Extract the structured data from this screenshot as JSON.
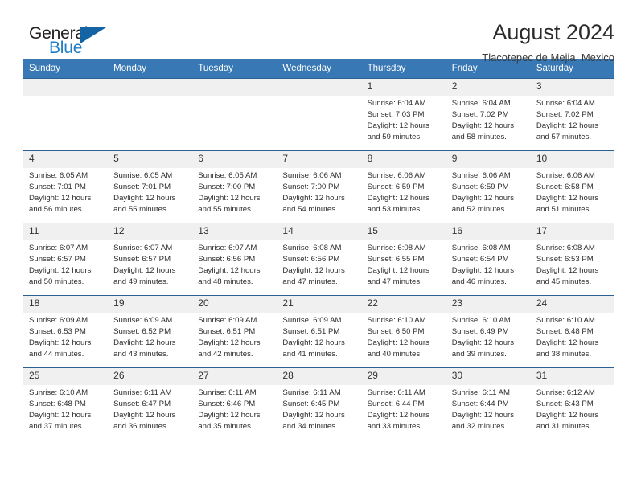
{
  "brand": {
    "name_top": "General",
    "name_bottom": "Blue",
    "accent_color": "#1f7dc4",
    "triangle_color": "#1464a5"
  },
  "header": {
    "title": "August 2024",
    "subtitle": "Tlacotepec de Mejia, Mexico"
  },
  "theme": {
    "header_row_bg": "#3878b4",
    "row_border": "#2c5f92",
    "daynum_bg": "#f0f0f0"
  },
  "weekday_headers": [
    "Sunday",
    "Monday",
    "Tuesday",
    "Wednesday",
    "Thursday",
    "Friday",
    "Saturday"
  ],
  "weeks": [
    [
      {
        "day": "",
        "sunrise": "",
        "sunset": "",
        "daylight_line1": "",
        "daylight_line2": ""
      },
      {
        "day": "",
        "sunrise": "",
        "sunset": "",
        "daylight_line1": "",
        "daylight_line2": ""
      },
      {
        "day": "",
        "sunrise": "",
        "sunset": "",
        "daylight_line1": "",
        "daylight_line2": ""
      },
      {
        "day": "",
        "sunrise": "",
        "sunset": "",
        "daylight_line1": "",
        "daylight_line2": ""
      },
      {
        "day": "1",
        "sunrise": "Sunrise: 6:04 AM",
        "sunset": "Sunset: 7:03 PM",
        "daylight_line1": "Daylight: 12 hours",
        "daylight_line2": "and 59 minutes."
      },
      {
        "day": "2",
        "sunrise": "Sunrise: 6:04 AM",
        "sunset": "Sunset: 7:02 PM",
        "daylight_line1": "Daylight: 12 hours",
        "daylight_line2": "and 58 minutes."
      },
      {
        "day": "3",
        "sunrise": "Sunrise: 6:04 AM",
        "sunset": "Sunset: 7:02 PM",
        "daylight_line1": "Daylight: 12 hours",
        "daylight_line2": "and 57 minutes."
      }
    ],
    [
      {
        "day": "4",
        "sunrise": "Sunrise: 6:05 AM",
        "sunset": "Sunset: 7:01 PM",
        "daylight_line1": "Daylight: 12 hours",
        "daylight_line2": "and 56 minutes."
      },
      {
        "day": "5",
        "sunrise": "Sunrise: 6:05 AM",
        "sunset": "Sunset: 7:01 PM",
        "daylight_line1": "Daylight: 12 hours",
        "daylight_line2": "and 55 minutes."
      },
      {
        "day": "6",
        "sunrise": "Sunrise: 6:05 AM",
        "sunset": "Sunset: 7:00 PM",
        "daylight_line1": "Daylight: 12 hours",
        "daylight_line2": "and 55 minutes."
      },
      {
        "day": "7",
        "sunrise": "Sunrise: 6:06 AM",
        "sunset": "Sunset: 7:00 PM",
        "daylight_line1": "Daylight: 12 hours",
        "daylight_line2": "and 54 minutes."
      },
      {
        "day": "8",
        "sunrise": "Sunrise: 6:06 AM",
        "sunset": "Sunset: 6:59 PM",
        "daylight_line1": "Daylight: 12 hours",
        "daylight_line2": "and 53 minutes."
      },
      {
        "day": "9",
        "sunrise": "Sunrise: 6:06 AM",
        "sunset": "Sunset: 6:59 PM",
        "daylight_line1": "Daylight: 12 hours",
        "daylight_line2": "and 52 minutes."
      },
      {
        "day": "10",
        "sunrise": "Sunrise: 6:06 AM",
        "sunset": "Sunset: 6:58 PM",
        "daylight_line1": "Daylight: 12 hours",
        "daylight_line2": "and 51 minutes."
      }
    ],
    [
      {
        "day": "11",
        "sunrise": "Sunrise: 6:07 AM",
        "sunset": "Sunset: 6:57 PM",
        "daylight_line1": "Daylight: 12 hours",
        "daylight_line2": "and 50 minutes."
      },
      {
        "day": "12",
        "sunrise": "Sunrise: 6:07 AM",
        "sunset": "Sunset: 6:57 PM",
        "daylight_line1": "Daylight: 12 hours",
        "daylight_line2": "and 49 minutes."
      },
      {
        "day": "13",
        "sunrise": "Sunrise: 6:07 AM",
        "sunset": "Sunset: 6:56 PM",
        "daylight_line1": "Daylight: 12 hours",
        "daylight_line2": "and 48 minutes."
      },
      {
        "day": "14",
        "sunrise": "Sunrise: 6:08 AM",
        "sunset": "Sunset: 6:56 PM",
        "daylight_line1": "Daylight: 12 hours",
        "daylight_line2": "and 47 minutes."
      },
      {
        "day": "15",
        "sunrise": "Sunrise: 6:08 AM",
        "sunset": "Sunset: 6:55 PM",
        "daylight_line1": "Daylight: 12 hours",
        "daylight_line2": "and 47 minutes."
      },
      {
        "day": "16",
        "sunrise": "Sunrise: 6:08 AM",
        "sunset": "Sunset: 6:54 PM",
        "daylight_line1": "Daylight: 12 hours",
        "daylight_line2": "and 46 minutes."
      },
      {
        "day": "17",
        "sunrise": "Sunrise: 6:08 AM",
        "sunset": "Sunset: 6:53 PM",
        "daylight_line1": "Daylight: 12 hours",
        "daylight_line2": "and 45 minutes."
      }
    ],
    [
      {
        "day": "18",
        "sunrise": "Sunrise: 6:09 AM",
        "sunset": "Sunset: 6:53 PM",
        "daylight_line1": "Daylight: 12 hours",
        "daylight_line2": "and 44 minutes."
      },
      {
        "day": "19",
        "sunrise": "Sunrise: 6:09 AM",
        "sunset": "Sunset: 6:52 PM",
        "daylight_line1": "Daylight: 12 hours",
        "daylight_line2": "and 43 minutes."
      },
      {
        "day": "20",
        "sunrise": "Sunrise: 6:09 AM",
        "sunset": "Sunset: 6:51 PM",
        "daylight_line1": "Daylight: 12 hours",
        "daylight_line2": "and 42 minutes."
      },
      {
        "day": "21",
        "sunrise": "Sunrise: 6:09 AM",
        "sunset": "Sunset: 6:51 PM",
        "daylight_line1": "Daylight: 12 hours",
        "daylight_line2": "and 41 minutes."
      },
      {
        "day": "22",
        "sunrise": "Sunrise: 6:10 AM",
        "sunset": "Sunset: 6:50 PM",
        "daylight_line1": "Daylight: 12 hours",
        "daylight_line2": "and 40 minutes."
      },
      {
        "day": "23",
        "sunrise": "Sunrise: 6:10 AM",
        "sunset": "Sunset: 6:49 PM",
        "daylight_line1": "Daylight: 12 hours",
        "daylight_line2": "and 39 minutes."
      },
      {
        "day": "24",
        "sunrise": "Sunrise: 6:10 AM",
        "sunset": "Sunset: 6:48 PM",
        "daylight_line1": "Daylight: 12 hours",
        "daylight_line2": "and 38 minutes."
      }
    ],
    [
      {
        "day": "25",
        "sunrise": "Sunrise: 6:10 AM",
        "sunset": "Sunset: 6:48 PM",
        "daylight_line1": "Daylight: 12 hours",
        "daylight_line2": "and 37 minutes."
      },
      {
        "day": "26",
        "sunrise": "Sunrise: 6:11 AM",
        "sunset": "Sunset: 6:47 PM",
        "daylight_line1": "Daylight: 12 hours",
        "daylight_line2": "and 36 minutes."
      },
      {
        "day": "27",
        "sunrise": "Sunrise: 6:11 AM",
        "sunset": "Sunset: 6:46 PM",
        "daylight_line1": "Daylight: 12 hours",
        "daylight_line2": "and 35 minutes."
      },
      {
        "day": "28",
        "sunrise": "Sunrise: 6:11 AM",
        "sunset": "Sunset: 6:45 PM",
        "daylight_line1": "Daylight: 12 hours",
        "daylight_line2": "and 34 minutes."
      },
      {
        "day": "29",
        "sunrise": "Sunrise: 6:11 AM",
        "sunset": "Sunset: 6:44 PM",
        "daylight_line1": "Daylight: 12 hours",
        "daylight_line2": "and 33 minutes."
      },
      {
        "day": "30",
        "sunrise": "Sunrise: 6:11 AM",
        "sunset": "Sunset: 6:44 PM",
        "daylight_line1": "Daylight: 12 hours",
        "daylight_line2": "and 32 minutes."
      },
      {
        "day": "31",
        "sunrise": "Sunrise: 6:12 AM",
        "sunset": "Sunset: 6:43 PM",
        "daylight_line1": "Daylight: 12 hours",
        "daylight_line2": "and 31 minutes."
      }
    ]
  ]
}
